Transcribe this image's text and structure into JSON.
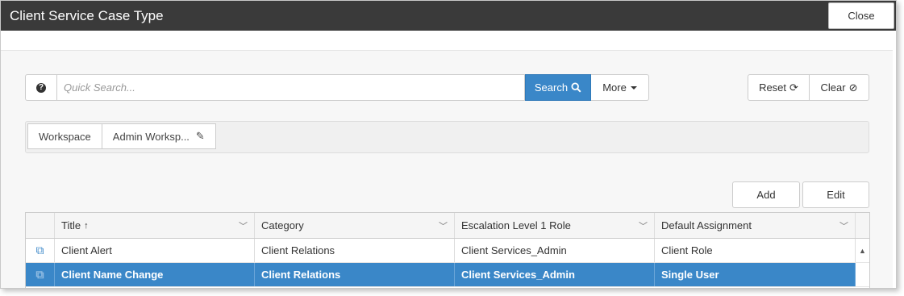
{
  "window": {
    "title": "Client Service Case Type",
    "close_label": "Close"
  },
  "search": {
    "help_icon": "question-circle-icon",
    "placeholder": "Quick Search...",
    "search_label": "Search",
    "search_icon": "search-icon",
    "more_label": "More"
  },
  "toolbar": {
    "reset_label": "Reset",
    "clear_label": "Clear"
  },
  "workspace": {
    "tabs": [
      "Workspace",
      "Admin Worksp..."
    ]
  },
  "actions": {
    "add_label": "Add",
    "edit_label": "Edit"
  },
  "grid": {
    "columns": [
      {
        "label": "Title",
        "sort": "ascending"
      },
      {
        "label": "Category"
      },
      {
        "label": "Escalation Level 1 Role"
      },
      {
        "label": "Default Assignment"
      }
    ],
    "rows": [
      {
        "title": "Client Alert",
        "category": "Client Relations",
        "role": "Client Services_Admin",
        "assignment": "Client Role",
        "selected": false
      },
      {
        "title": "Client Name Change",
        "category": "Client Relations",
        "role": "Client Services_Admin",
        "assignment": "Single User",
        "selected": true
      }
    ]
  },
  "colors": {
    "titlebar": "#3a3a3a",
    "accent": "#3a87c8"
  }
}
